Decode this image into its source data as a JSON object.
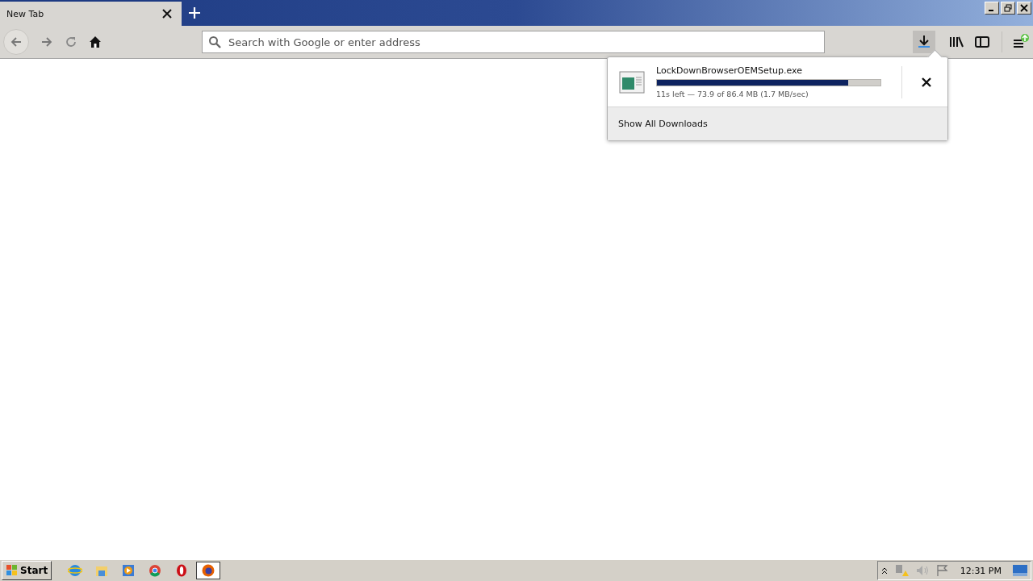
{
  "tabs": [
    {
      "label": "New Tab",
      "selected": true
    }
  ],
  "address_bar": {
    "placeholder": "Search with Google or enter address"
  },
  "downloads_panel": {
    "file_name": "LockDownBrowserOEMSetup.exe",
    "level": 0.855,
    "status": "11s left — 73.9 of 86.4 MB (1.7 MB/sec)",
    "footer": "Show All Downloads"
  },
  "taskbar": {
    "start": "Start",
    "apps": [
      {
        "kind": "ie",
        "selected": false
      },
      {
        "kind": "folder",
        "selected": false
      },
      {
        "kind": "media",
        "selected": false
      },
      {
        "kind": "chrome",
        "selected": false
      },
      {
        "kind": "opera",
        "selected": false
      },
      {
        "kind": "firefox",
        "selected": true
      }
    ],
    "clock": "12:31 PM"
  }
}
